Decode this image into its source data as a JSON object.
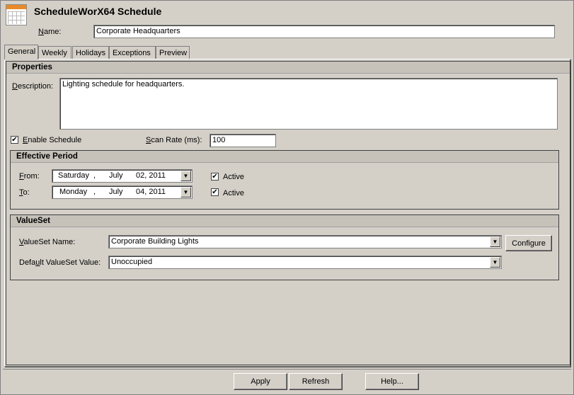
{
  "header": {
    "title": "ScheduleWorX64 Schedule",
    "name_label": "Name:",
    "name_value": "Corporate Headquarters"
  },
  "tabs": [
    {
      "label": "General"
    },
    {
      "label": "Weekly"
    },
    {
      "label": "Holidays"
    },
    {
      "label": "Exceptions"
    },
    {
      "label": "Preview"
    }
  ],
  "properties": {
    "heading": "Properties",
    "description_label": "Description:",
    "description_value": "Lighting schedule for headquarters.",
    "enable_label": "Enable Schedule",
    "enable_checked": "✔",
    "scan_rate_label": "Scan Rate (ms):",
    "scan_rate_value": "100"
  },
  "effective_period": {
    "heading": "Effective Period",
    "from_label": "From:",
    "from": {
      "weekday": "Saturday",
      "sep": ",",
      "month": "July",
      "day_year": "02, 2011"
    },
    "to_label": "To:",
    "to": {
      "weekday": "Monday",
      "sep": ",",
      "month": "July",
      "day_year": "04, 2011"
    },
    "active_label": "Active",
    "active_checked": "✔"
  },
  "valueset": {
    "heading": "ValueSet",
    "name_label": "ValueSet Name:",
    "name_value": "Corporate Building Lights",
    "default_label": "Default ValueSet Value:",
    "default_value": "Unoccupied",
    "configure_label": "Configure"
  },
  "footer": {
    "apply_label": "Apply",
    "refresh_label": "Refresh",
    "help_label": "Help..."
  },
  "icons": {
    "app": "calendar-icon",
    "dropdown": "dropdown-arrow-icon"
  }
}
